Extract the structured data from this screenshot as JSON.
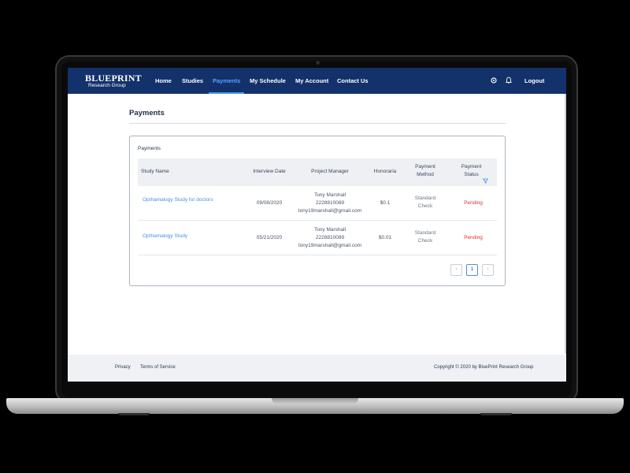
{
  "brand": {
    "logo_main": "BLUEPRINT",
    "logo_sub": "Research Group",
    "nav_bg": "#13316b",
    "accent": "#4a90f0"
  },
  "nav": {
    "items": [
      "Home",
      "Studies",
      "Payments",
      "My Schedule",
      "My Account",
      "Contact Us"
    ],
    "active": "Payments",
    "settings_icon": "gear-icon",
    "notification_icon": "bell-icon",
    "logout": "Logout"
  },
  "page": {
    "title": "Payments"
  },
  "payments_card": {
    "title": "Payments",
    "columns": [
      "Study Name",
      "Interview Date",
      "Project Manager",
      "Honoraria",
      "Payment Method",
      "Payment Status"
    ],
    "filter_icon": "filter-icon",
    "rows": [
      {
        "study_name": "Opthamalogy Study for doctors",
        "interview_date": "09/08/2020",
        "manager_name": "Tony Marshall",
        "manager_phone": "2228810089",
        "manager_email": "tony19marshall@gmail.com",
        "honoraria": "$0.1",
        "payment_method": "Standard Check",
        "payment_status": "Pending"
      },
      {
        "study_name": "Opthamalogy Study",
        "interview_date": "05/21/2020",
        "manager_name": "Tony Marshall",
        "manager_phone": "2228810089",
        "manager_email": "tony19marshall@gmail.com",
        "honoraria": "$0.01",
        "payment_method": "Standard Check",
        "payment_status": "Pending"
      }
    ],
    "pagination": {
      "prev": "‹",
      "current_page": "1",
      "next": "›"
    },
    "status_color": "#e0302a"
  },
  "footer": {
    "privacy": "Privacy",
    "terms": "Terms of Service",
    "copyright": "Copyright © 2020 by BluePrint Research Group"
  }
}
